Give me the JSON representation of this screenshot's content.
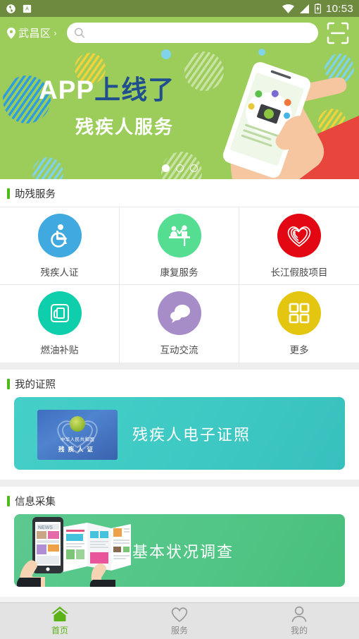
{
  "status_bar": {
    "time": "10:53",
    "icons": [
      "app-icon-sync",
      "app-icon-a",
      "wifi-icon",
      "signal-icon",
      "battery-charging-icon"
    ]
  },
  "header": {
    "location": "武昌区",
    "location_chevron": "›",
    "search_placeholder": "",
    "search_value": "",
    "search_icon": "search-icon",
    "scan_icon": "scan-code-icon"
  },
  "banner": {
    "title_en": "APP",
    "title_cn": "上线了",
    "subtitle": "残疾人服务",
    "dots": 3,
    "active_dot": 0,
    "bg_color": "#9ccc5a",
    "cn_color": "#1f4f8f"
  },
  "sections": [
    {
      "title": "助残服务"
    },
    {
      "title": "我的证照"
    },
    {
      "title": "信息采集"
    }
  ],
  "services": [
    {
      "label": "残疾人证",
      "icon": "wheelchair-icon",
      "color": "#3fa9e0"
    },
    {
      "label": "康复服务",
      "icon": "rehab-desk-icon",
      "color": "#55dd92"
    },
    {
      "label": "长江假肢项目",
      "icon": "heart-icon",
      "color": "#e30613"
    },
    {
      "label": "燃油补贴",
      "icon": "fuel-pump-icon",
      "color": "#0fceab"
    },
    {
      "label": "互动交流",
      "icon": "chat-bubbles-icon",
      "color": "#a68dc8"
    },
    {
      "label": "更多",
      "icon": "grid-squares-icon",
      "color": "#e4c610"
    }
  ],
  "certificate_card": {
    "text": "残疾人电子证照",
    "bg_color": "#3fc9c4",
    "thumb": {
      "country": "中华人民共和国",
      "name": "残疾人证"
    }
  },
  "survey_card": {
    "text": "基本状况调查",
    "bg_color": "#52c686",
    "art": "hand-holding-phone-brochure-illustration"
  },
  "tabbar": {
    "items": [
      {
        "label": "首页",
        "icon": "home-icon",
        "active": true
      },
      {
        "label": "服务",
        "icon": "heart-outline-icon",
        "active": false
      },
      {
        "label": "我的",
        "icon": "person-icon",
        "active": false
      }
    ],
    "active_color": "#5cb317"
  }
}
